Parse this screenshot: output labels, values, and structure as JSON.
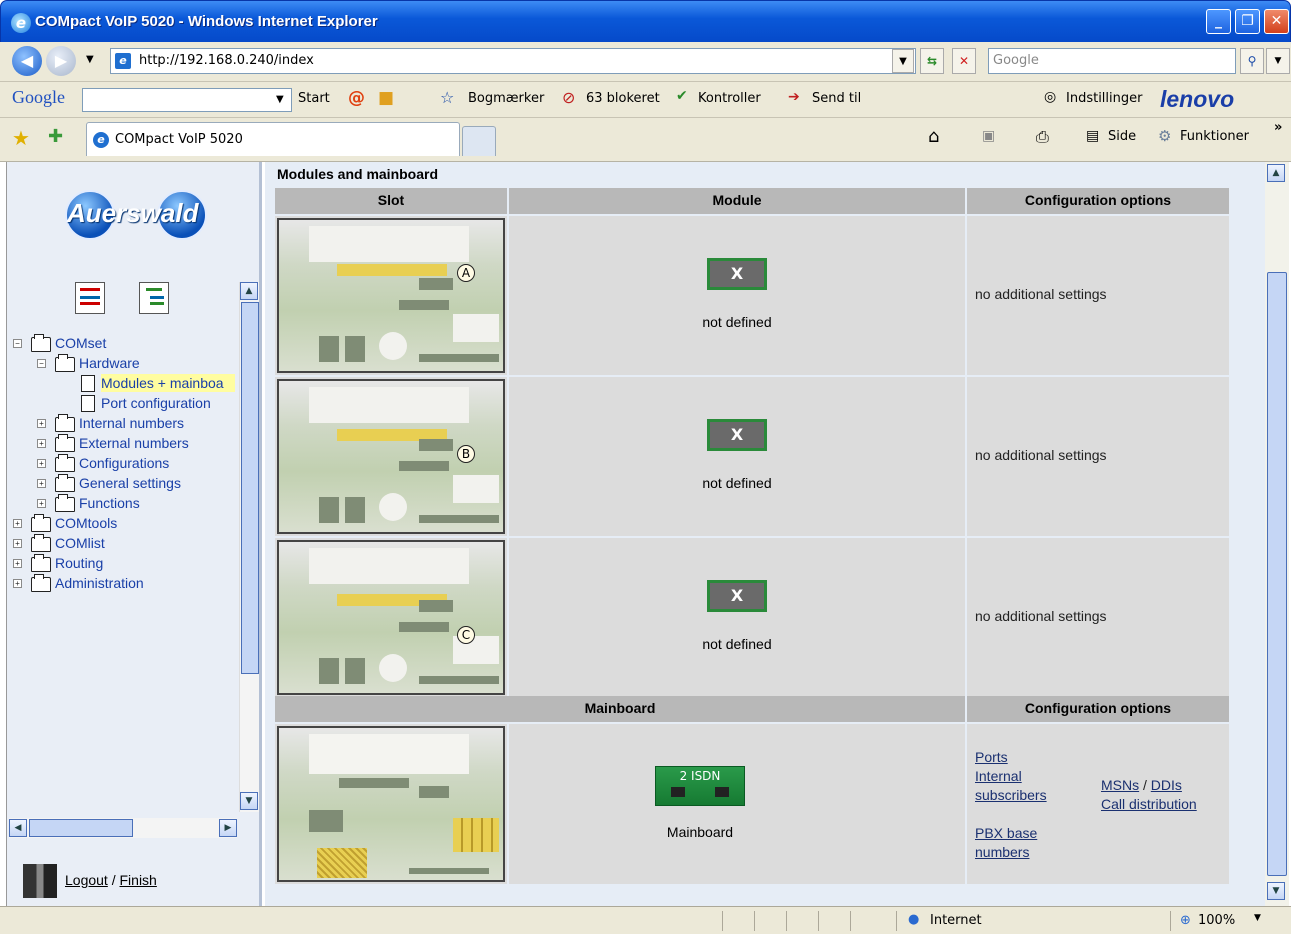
{
  "window": {
    "title": "COMpact VoIP 5020 - Windows Internet Explorer"
  },
  "address": {
    "url": "http://192.168.0.240/index",
    "search_placeholder": "Google"
  },
  "google_toolbar": {
    "logo": "Google",
    "start": "Start",
    "bookmarks": "Bogmærker",
    "blocked": "63 blokeret",
    "check": "Kontroller",
    "send": "Send til",
    "settings": "Indstillinger",
    "brand": "lenovo"
  },
  "favorites_bar": {
    "tab_title": "COMpact VoIP 5020",
    "page_menu": "Side",
    "tools_menu": "Funktioner"
  },
  "sidebar": {
    "logo_text": "Auerswald",
    "tree": [
      {
        "label": "COMset",
        "level": 0,
        "type": "folder-open"
      },
      {
        "label": "Hardware",
        "level": 1,
        "type": "folder-open"
      },
      {
        "label": "Modules + mainboa",
        "level": 2,
        "type": "doc",
        "selected": true
      },
      {
        "label": "Port configuration",
        "level": 2,
        "type": "doc"
      },
      {
        "label": "Internal numbers",
        "level": 1,
        "type": "folder"
      },
      {
        "label": "External numbers",
        "level": 1,
        "type": "folder"
      },
      {
        "label": "Configurations",
        "level": 1,
        "type": "folder"
      },
      {
        "label": "General settings",
        "level": 1,
        "type": "folder"
      },
      {
        "label": "Functions",
        "level": 1,
        "type": "folder"
      },
      {
        "label": "COMtools",
        "level": 0,
        "type": "folder"
      },
      {
        "label": "COMlist",
        "level": 0,
        "type": "folder"
      },
      {
        "label": "Routing",
        "level": 0,
        "type": "folder"
      },
      {
        "label": "Administration",
        "level": 0,
        "type": "folder"
      }
    ],
    "logout": "Logout",
    "separator": "/",
    "finish": "Finish"
  },
  "main": {
    "section_title": "Modules and mainboard",
    "headers": {
      "slot": "Slot",
      "module": "Module",
      "config": "Configuration options"
    },
    "slots": [
      {
        "badge": "A",
        "module_mark": "X",
        "module_label": "not defined",
        "options": "no additional settings"
      },
      {
        "badge": "B",
        "module_mark": "X",
        "module_label": "not defined",
        "options": "no additional settings"
      },
      {
        "badge": "C",
        "module_mark": "X",
        "module_label": "not defined",
        "options": "no additional settings"
      }
    ],
    "mainboard": {
      "header": "Mainboard",
      "config_header": "Configuration options",
      "chip_label": "2 ISDN",
      "label": "Mainboard",
      "links": {
        "ports": "Ports",
        "internal_subscribers_1": "Internal",
        "internal_subscribers_2": "subscribers",
        "pbx_base_1": "PBX base",
        "pbx_base_2": "numbers",
        "msns": "MSNs",
        "slash": "/",
        "ddis": "DDIs",
        "call_distribution": "Call distribution"
      }
    }
  },
  "statusbar": {
    "zone": "Internet",
    "zoom": "100%"
  }
}
